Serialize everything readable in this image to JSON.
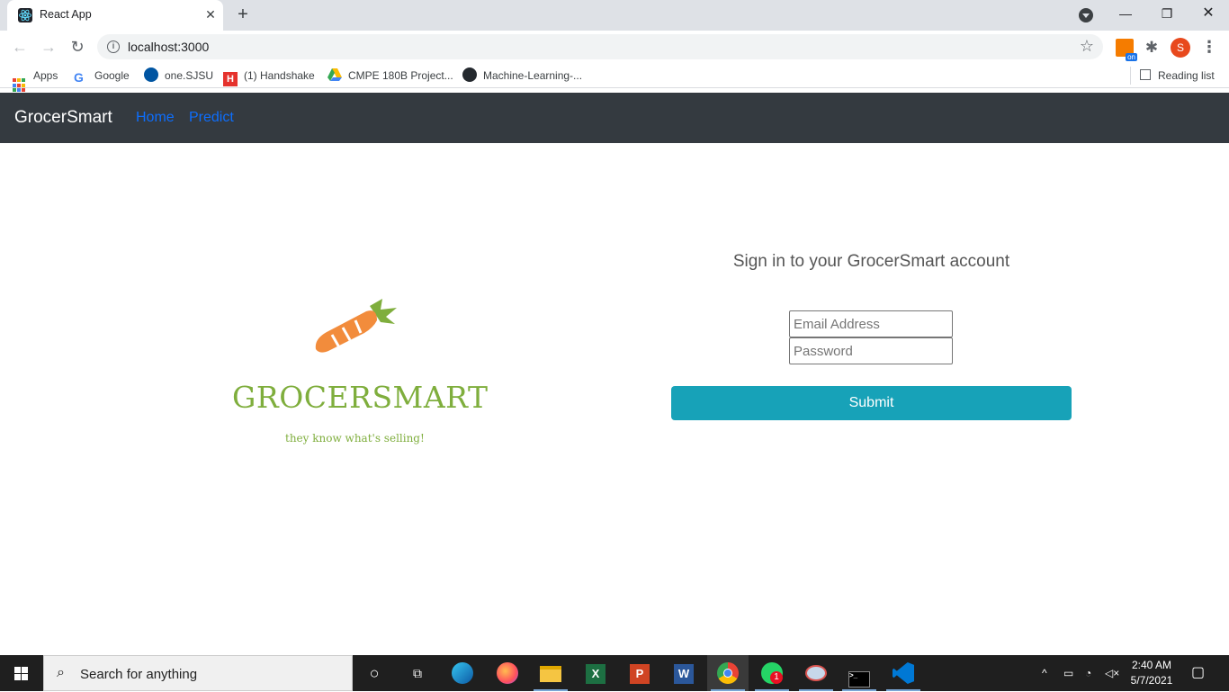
{
  "browser": {
    "tab_title": "React App",
    "url": "localhost:3000",
    "profile_initial": "S",
    "ext_badge": "on",
    "bookmarks": [
      "Apps",
      "Google",
      "one.SJSU",
      "(1) Handshake",
      "CMPE 180B Project...",
      "Machine-Learning-..."
    ],
    "reading_list": "Reading list"
  },
  "app": {
    "brand": "GrocerSmart",
    "nav_links": [
      "Home",
      "Predict"
    ],
    "logo_text": "GROCERSMART",
    "tagline": "they know what's selling!",
    "signin_title": "Sign in to your GrocerSmart account",
    "email_placeholder": "Email Address",
    "password_placeholder": "Password",
    "submit_label": "Submit",
    "colors": {
      "navbar": "#343a40",
      "link": "#0d6efd",
      "submit": "#17a2b8",
      "logo_green": "#7fae3d",
      "carrot_orange": "#f28c3c"
    }
  },
  "taskbar": {
    "search_placeholder": "Search for anything",
    "time": "2:40 AM",
    "date": "5/7/2021",
    "whatsapp_badge": "1"
  }
}
